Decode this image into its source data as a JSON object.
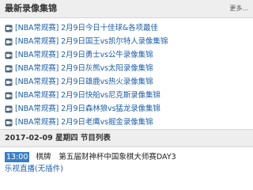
{
  "header": {
    "title": "最新录像集锦",
    "more_label": "更多..."
  },
  "recordings": [
    {
      "text": "[NBA常规赛] 2月9日今日十佳球&各项最佳"
    },
    {
      "text": "[NBA常规赛] 2月9日国王vs凯尔特人录像集锦"
    },
    {
      "text": "[NBA常规赛] 2月9日勇士vs公牛录像集锦"
    },
    {
      "text": "[NBA常规赛] 2月9日灰熊vs太阳录像集锦"
    },
    {
      "text": "[NBA常规赛] 2月9日雄鹿vs热火录像集锦"
    },
    {
      "text": "[NBA常规赛] 2月9日快船vs尼克斯录像集锦"
    },
    {
      "text": "[NBA常规赛] 2月9日森林狼vs猛龙录像集锦"
    },
    {
      "text": "[NBA常规赛] 2月9日老鹰vs掘金录像集锦"
    }
  ],
  "schedule": {
    "title": "2017-02-09 星期四 节目列表",
    "program": {
      "time": "13:00",
      "category": "棋牌",
      "title": "第五届财神杯中国象棋大师赛DAY3"
    },
    "live_link": "乐视直播(无插件)"
  },
  "colors": {
    "link": "#1f5fa8",
    "time_badge": "#3a7fc4",
    "header_bg": "#eeeeee"
  },
  "icons": {
    "recording": "video-camera-icon"
  }
}
